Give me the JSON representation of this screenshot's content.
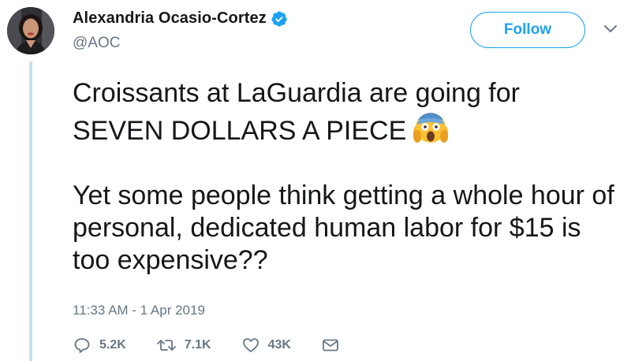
{
  "user": {
    "display_name": "Alexandria Ocasio-Cortez",
    "handle": "@AOC",
    "verified": true,
    "avatar_icon": "profile-photo"
  },
  "follow_button": {
    "label": "Follow"
  },
  "tweet": {
    "paragraph_1_line_1": "Croissants at LaGuardia are going for",
    "paragraph_1_line_2": "SEVEN DOLLARS A PIECE",
    "emoji": "face-screaming-in-fear",
    "paragraph_2": "Yet some people think getting a whole hour of personal, dedicated human labor for $15 is too expensive??",
    "timestamp": "11:33 AM - 1 Apr 2019"
  },
  "actions": {
    "replies": "5.2K",
    "retweets": "7.1K",
    "likes": "43K"
  },
  "colors": {
    "brand_blue": "#1da1f2",
    "secondary_text": "#657786",
    "primary_text": "#14171a",
    "thread_line": "#c4dff5"
  }
}
